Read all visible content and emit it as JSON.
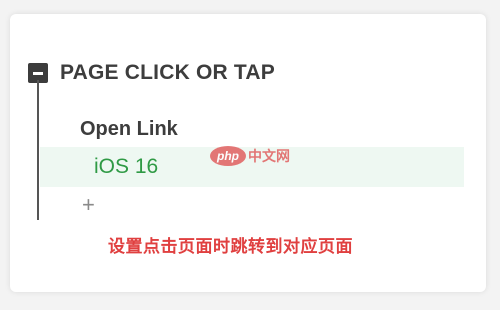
{
  "section": {
    "title": "PAGE CLICK OR TAP",
    "collapse_icon": "minus-square-icon"
  },
  "action": {
    "label": "Open Link"
  },
  "option": {
    "value": "iOS 16",
    "highlight_color": "#eef8f2",
    "text_color": "#2f9a45"
  },
  "add": {
    "symbol": "+"
  },
  "watermark": {
    "logo": "php",
    "text": "中文网"
  },
  "caption": {
    "text": "设置点击页面时跳转到对应页面"
  }
}
